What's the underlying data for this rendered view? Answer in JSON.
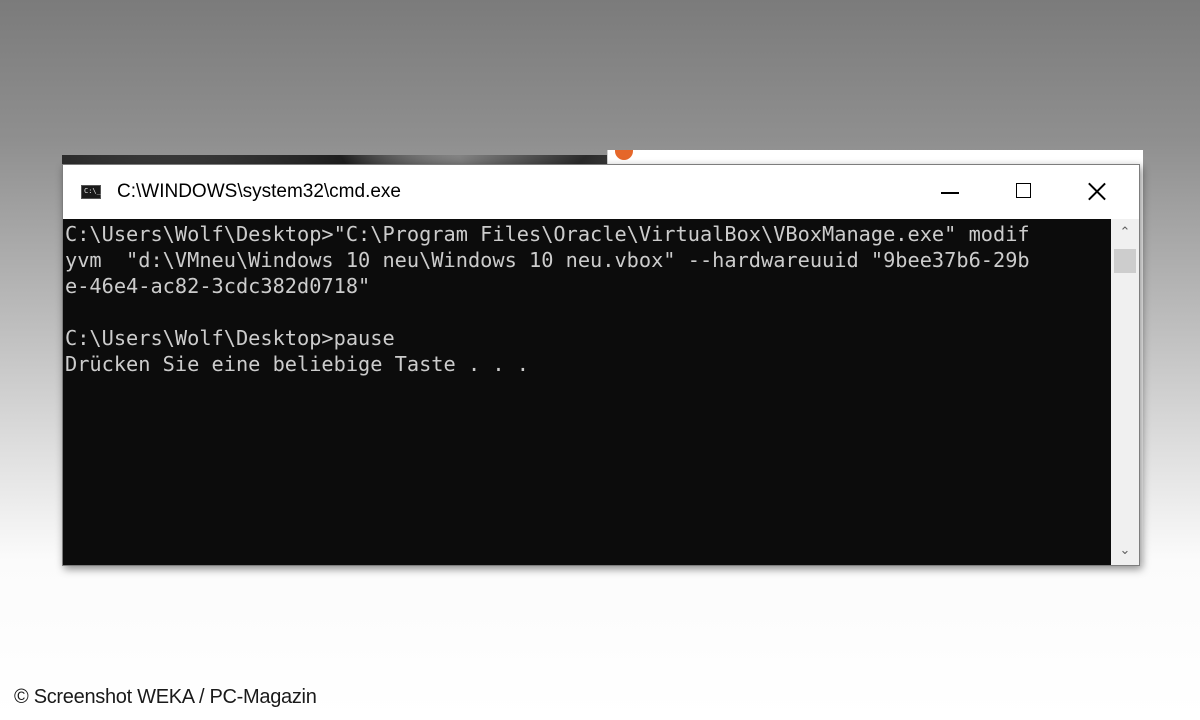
{
  "window": {
    "title": "C:\\WINDOWS\\system32\\cmd.exe",
    "icon": "cmd-icon",
    "icon_text": "C:\\_"
  },
  "controls": {
    "minimize_icon": "minimize-icon",
    "maximize_icon": "maximize-icon",
    "close_icon": "close-icon"
  },
  "console": {
    "lines": [
      "C:\\Users\\Wolf\\Desktop>\"C:\\Program Files\\Oracle\\VirtualBox\\VBoxManage.exe\" modif",
      "yvm  \"d:\\VMneu\\Windows 10 neu\\Windows 10 neu.vbox\" --hardwareuuid \"9bee37b6-29b",
      "e-46e4-ac82-3cdc382d0718\"",
      "",
      "C:\\Users\\Wolf\\Desktop>pause",
      "Drücken Sie eine beliebige Taste . . ."
    ],
    "background_color": "#0c0c0c",
    "text_color": "#cccccc"
  },
  "scrollbar": {
    "up_glyph": "⌃",
    "down_glyph": "⌄"
  },
  "credit": "© Screenshot WEKA / PC-Magazin"
}
